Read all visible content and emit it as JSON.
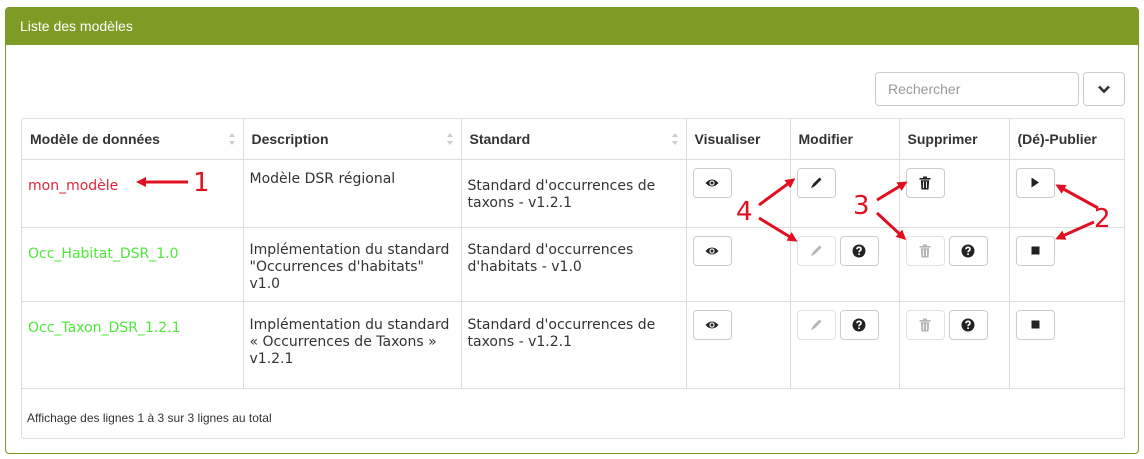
{
  "panel": {
    "title": "Liste des modèles"
  },
  "search": {
    "placeholder": "Rechercher"
  },
  "table": {
    "columns": [
      "Modèle de données",
      "Description",
      "Standard",
      "Visualiser",
      "Modifier",
      "Supprimer",
      "(Dé)-Publier"
    ],
    "rows": [
      {
        "model": "mon_modèle",
        "description": "Modèle DSR régional",
        "standard": "Standard d'occurrences de taxons - v1.2.1",
        "status_color": "#e0263c"
      },
      {
        "model": "Occ_Habitat_DSR_1.0",
        "description": "Implémentation du standard \"Occurrences d'habitats\" v1.0",
        "standard": "Standard d'occurrences d'habitats - v1.0",
        "status_color": "#4ee83a"
      },
      {
        "model": "Occ_Taxon_DSR_1.2.1",
        "description": "Implémentation du standard « Occurrences de Taxons » v1.2.1",
        "standard": "Standard d'occurrences de taxons - v1.2.1",
        "status_color": "#4ee83a"
      }
    ]
  },
  "footer": {
    "text": "Affichage des lignes 1 à 3 sur 3 lignes au total"
  },
  "annotations": {
    "a1": "1",
    "a2": "2",
    "a3": "3",
    "a4": "4"
  },
  "icons": [
    "eye-icon",
    "pencil-icon",
    "trash-icon",
    "play-icon",
    "stop-icon",
    "question-icon",
    "chevron-down-icon",
    "sort-icon"
  ],
  "colors": {
    "header_bg": "#7e9b26",
    "annotation": "#e01020"
  }
}
